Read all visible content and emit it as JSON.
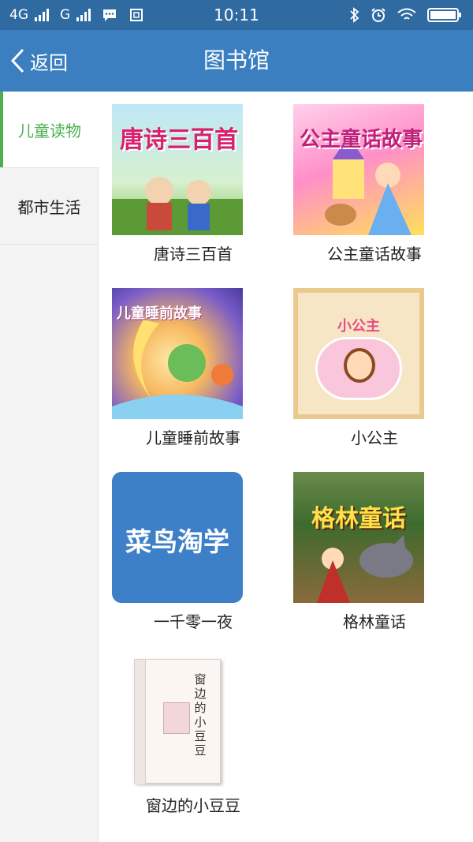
{
  "status_bar": {
    "network_left": "4G",
    "network_right": "G",
    "time": "10:11"
  },
  "header": {
    "back_label": "返回",
    "title": "图书馆"
  },
  "sidebar": {
    "items": [
      {
        "label": "儿童读物",
        "active": true
      },
      {
        "label": "都市生活",
        "active": false
      }
    ]
  },
  "books": [
    {
      "title": "唐诗三百首",
      "cover_text": "唐诗三百首"
    },
    {
      "title": "公主童话故事",
      "cover_text": "公主童话故事"
    },
    {
      "title": "儿童睡前故事",
      "cover_text": "儿童睡前故事"
    },
    {
      "title": "小公主",
      "cover_text": "小公主"
    },
    {
      "title": "一千零一夜",
      "cover_text": "菜鸟淘学"
    },
    {
      "title": "格林童话",
      "cover_text": "格林童话"
    },
    {
      "title": "窗边的小豆豆",
      "cover_text": "窗边的小豆豆"
    }
  ],
  "colors": {
    "status_bar": "#2f6aa1",
    "title_bar": "#3b7fc0",
    "accent_green": "#4caf50",
    "sidebar_bg": "#f3f3f3"
  }
}
